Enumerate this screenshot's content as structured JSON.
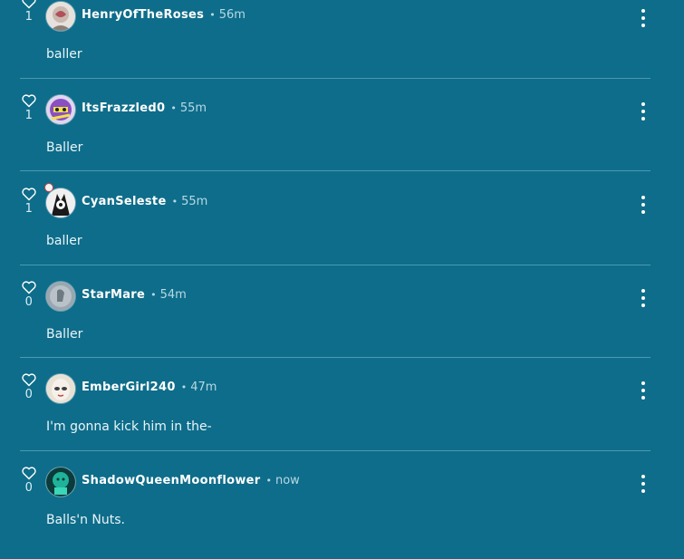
{
  "comments": [
    {
      "username": "HenryOfTheRoses",
      "time": "56m",
      "likes": "1",
      "text": "baller",
      "avatar": "rose-avatar"
    },
    {
      "username": "ItsFrazzled0",
      "time": "55m",
      "likes": "1",
      "text": "Baller",
      "avatar": "purple-character-avatar"
    },
    {
      "username": "CyanSeleste",
      "time": "55m",
      "likes": "1",
      "text": "baller",
      "avatar": "monochrome-character-avatar"
    },
    {
      "username": "StarMare",
      "time": "54m",
      "likes": "0",
      "text": "Baller",
      "avatar": "gray-avatar"
    },
    {
      "username": "EmberGirl240",
      "time": "47m",
      "likes": "0",
      "text": "I'm gonna kick him in the-",
      "avatar": "pale-face-avatar"
    },
    {
      "username": "ShadowQueenMoonflower",
      "time": "now",
      "likes": "0",
      "text": "Balls'n Nuts.",
      "avatar": "teal-character-avatar"
    }
  ],
  "separator": "•",
  "colors": {
    "background": "#0e6d8a",
    "divider": "#4a9ab3",
    "secondary_text": "#b7d9e5"
  }
}
